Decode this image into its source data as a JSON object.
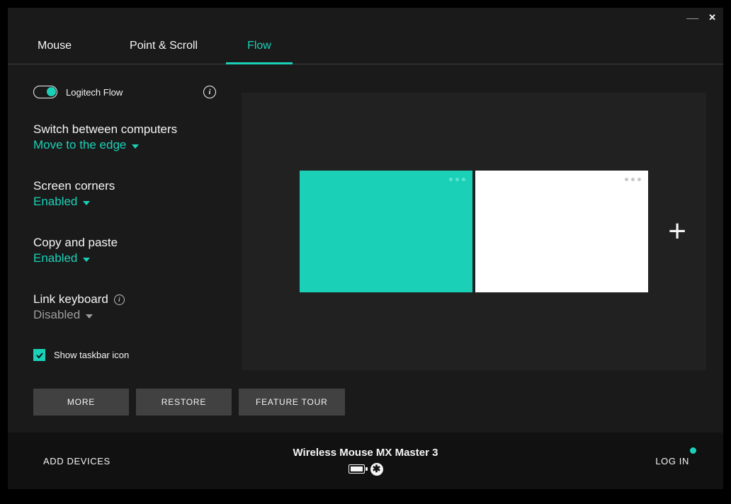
{
  "tabs": {
    "mouse": "Mouse",
    "point_scroll": "Point & Scroll",
    "flow": "Flow"
  },
  "flow": {
    "toggle_label": "Logitech Flow",
    "switch": {
      "title": "Switch between computers",
      "value": "Move to the edge"
    },
    "corners": {
      "title": "Screen corners",
      "value": "Enabled"
    },
    "copy": {
      "title": "Copy and paste",
      "value": "Enabled"
    },
    "keyboard": {
      "title": "Link keyboard",
      "value": "Disabled"
    },
    "show_taskbar": "Show taskbar icon"
  },
  "buttons": {
    "more": "MORE",
    "restore": "RESTORE",
    "tour": "FEATURE TOUR"
  },
  "bottom": {
    "add": "ADD DEVICES",
    "device": "Wireless Mouse MX Master 3",
    "login": "LOG IN"
  },
  "glyphs": {
    "plus": "+",
    "recv": "✱",
    "close": "✕",
    "min": "__"
  }
}
